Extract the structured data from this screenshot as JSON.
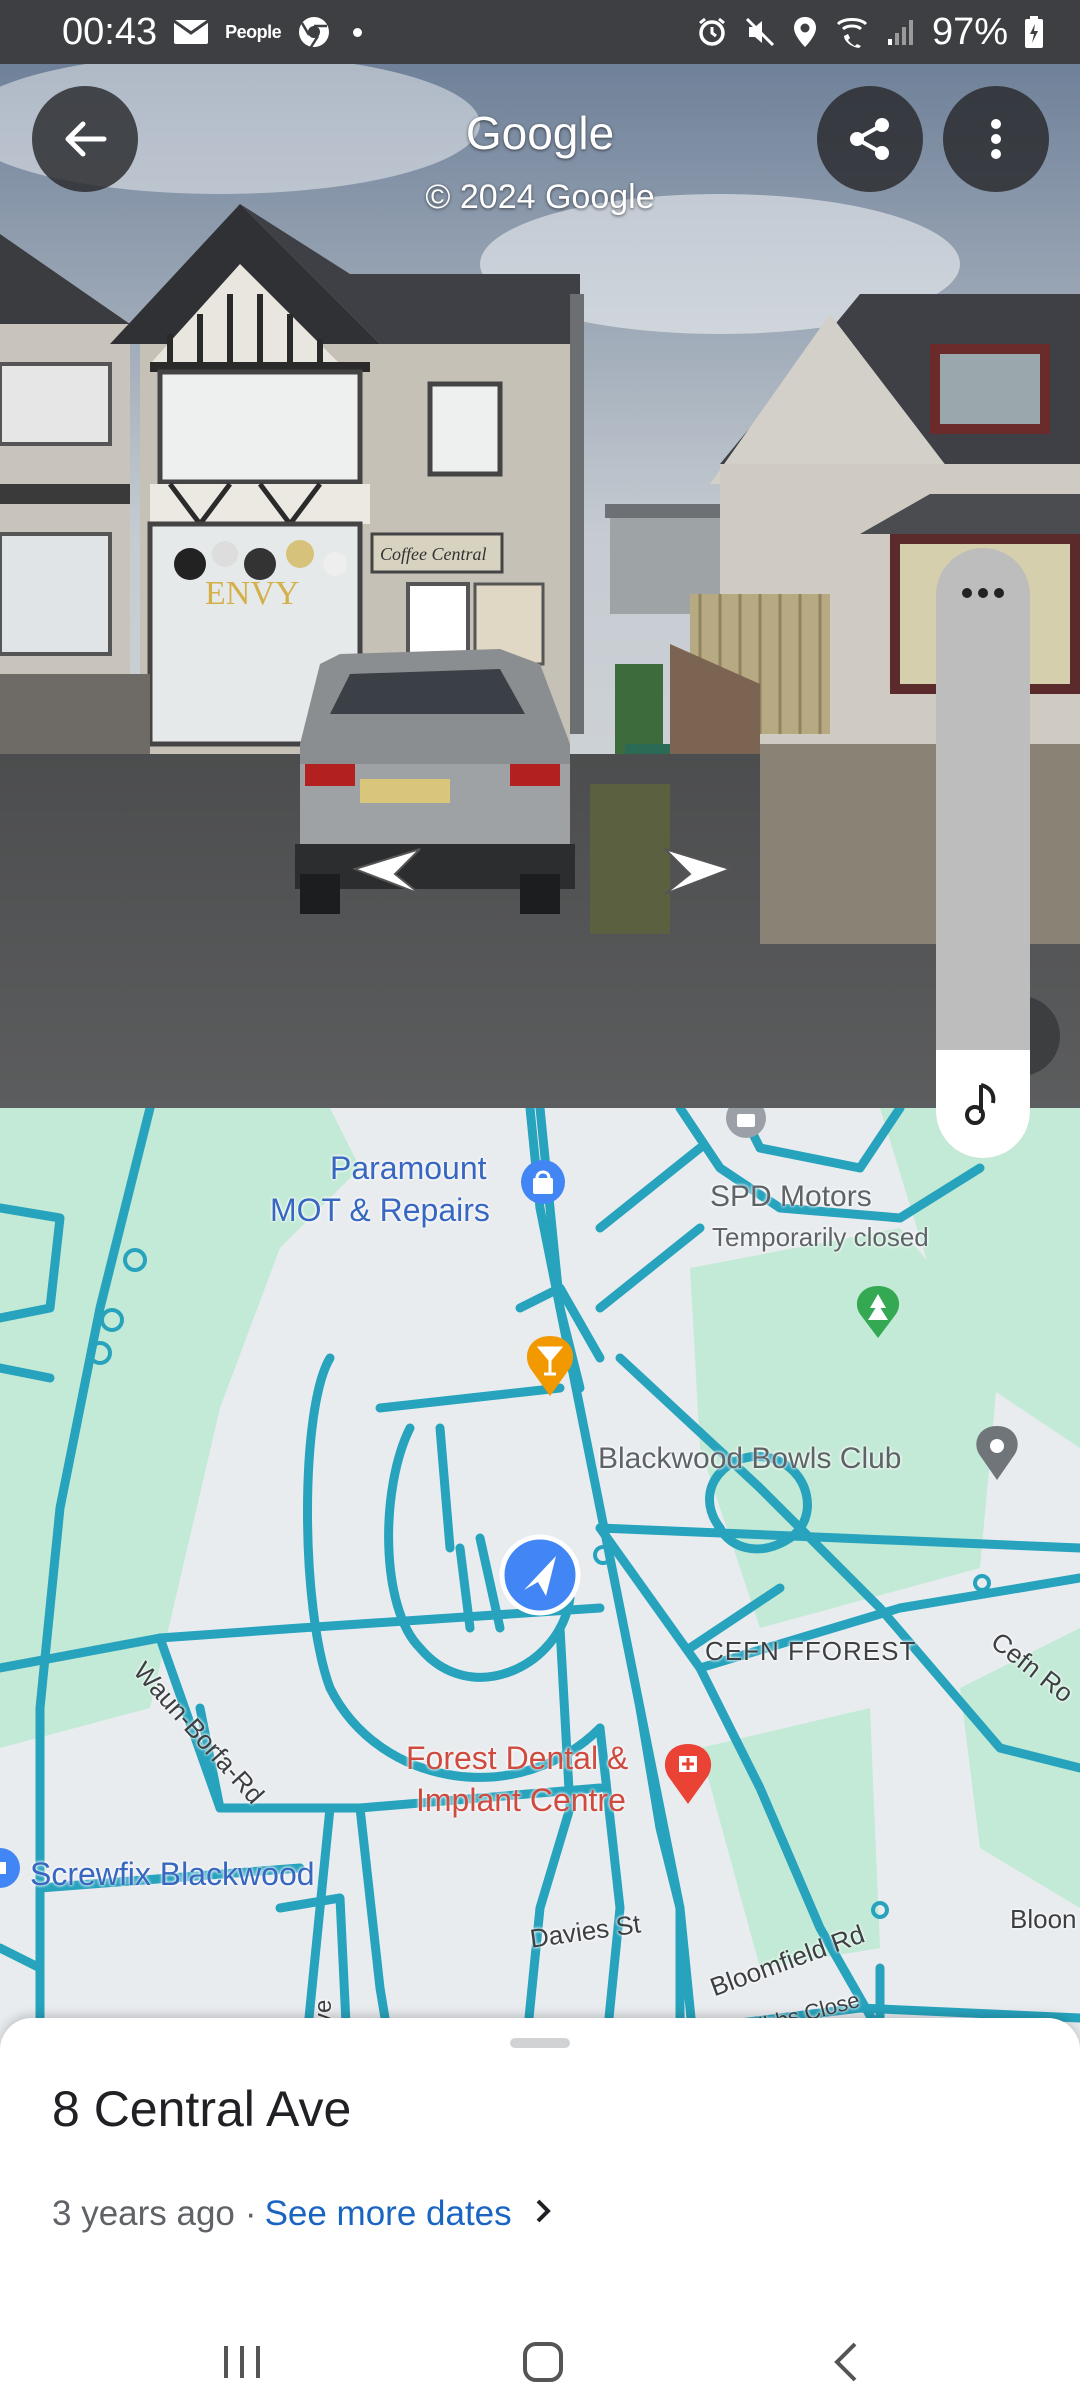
{
  "status_bar": {
    "time": "00:43",
    "people_label": "People",
    "battery": "97%"
  },
  "street_view": {
    "title": "Google",
    "copyright": "© 2024 Google",
    "sign_text": "ENVY",
    "shop_sign": "Coffee Central"
  },
  "map": {
    "labels": {
      "paramount_1": "Paramount",
      "paramount_2": "MOT & Repairs",
      "spd": "SPD Motors",
      "spd_status": "Temporarily closed",
      "bowls": "Blackwood Bowls Club",
      "cefn_fforest": "CEFN FFOREST",
      "cefn_rd": "Cefn Ro",
      "waun_borfa": "Waun-Borfa-Rd",
      "dental_1": "Forest Dental &",
      "dental_2": "Implant Centre",
      "screwfix": "Screwfix Blackwood",
      "davies": "Davies St",
      "bloomfield": "Bloomfield Rd",
      "gibbs": "Gibbs Close",
      "bloom": "Bloon",
      "alan_ave": "lan Ave"
    }
  },
  "sheet": {
    "title": "8 Central Ave",
    "age": "3 years ago",
    "separator": "·",
    "more_dates": "See more dates"
  },
  "colors": {
    "road": "#27a3bd",
    "park": "#c3ead6",
    "accent_blue": "#4285f4"
  }
}
